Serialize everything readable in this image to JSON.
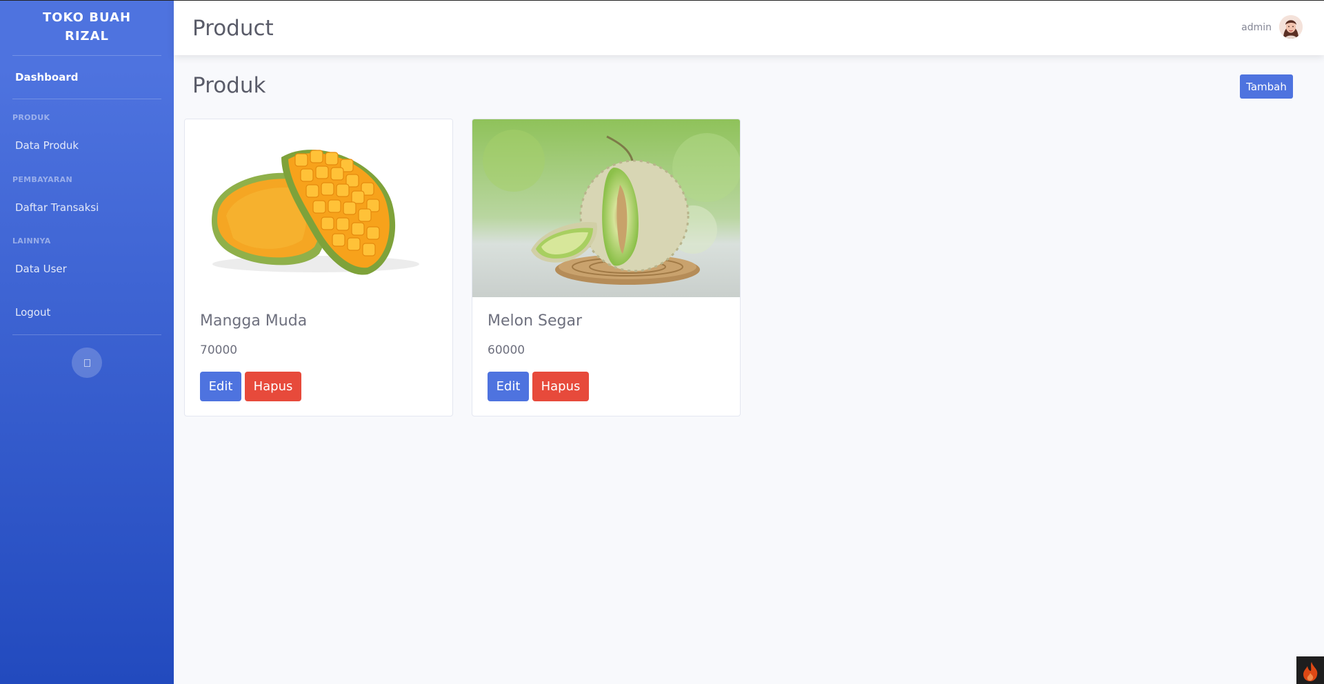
{
  "sidebar": {
    "brand_line1": "TOKO BUAH",
    "brand_line2": "RIZAL",
    "dashboard": "Dashboard",
    "heading_produk": "PRODUK",
    "data_produk": "Data Produk",
    "heading_pembayaran": "PEMBAYARAN",
    "daftar_transaksi": "Daftar Transaksi",
    "heading_lainnya": "LAINNYA",
    "data_user": "Data User",
    "logout": "Logout"
  },
  "topbar": {
    "title": "Product",
    "user_name": "admin"
  },
  "main": {
    "heading": "Produk",
    "add_label": "Tambah"
  },
  "products": [
    {
      "name": "Mangga Muda",
      "price": "70000",
      "edit_label": "Edit",
      "delete_label": "Hapus"
    },
    {
      "name": "Melon Segar",
      "price": "60000",
      "edit_label": "Edit",
      "delete_label": "Hapus"
    }
  ],
  "colors": {
    "primary": "#4e73df",
    "danger": "#e74a3b",
    "sidebar_bottom": "#224abe"
  }
}
